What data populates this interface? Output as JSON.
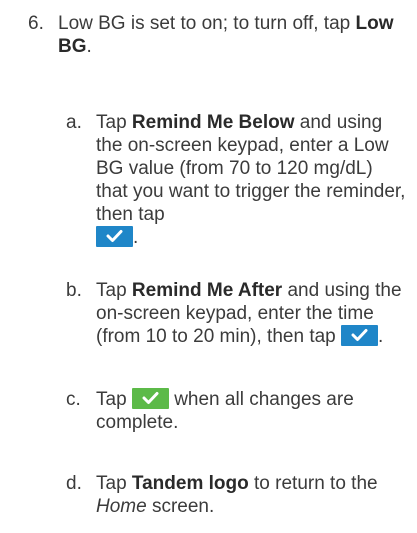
{
  "step": {
    "number": "6.",
    "text_before": "Low BG is set to on; to turn off, tap",
    "bold": "Low BG",
    "text_after": "."
  },
  "substeps": [
    {
      "letter": "a.",
      "tap": "Tap",
      "bold": "Remind Me Below",
      "text": "and using the on-screen keypad, enter a Low BG value (from 70 to 120 mg/dL) that you want to trigger the reminder, then tap",
      "end": ".",
      "icon": "check-button-blue-icon"
    },
    {
      "letter": "b.",
      "tap": "Tap",
      "bold": "Remind Me After",
      "text": "and using the on-screen keypad, enter the time (from 10 to 20 min), then tap",
      "end": ".",
      "icon": "check-button-blue-icon"
    },
    {
      "letter": "c.",
      "tap": "Tap",
      "text": "when all changes are complete.",
      "icon": "check-button-green-icon"
    },
    {
      "letter": "d.",
      "tap": "Tap",
      "bold": "Tandem logo",
      "text": "to return to the",
      "italic": "Home",
      "end": "screen."
    }
  ],
  "colors": {
    "check_blue": "#1f86c8",
    "check_green": "#5cba48",
    "text": "#3b3b3b"
  }
}
